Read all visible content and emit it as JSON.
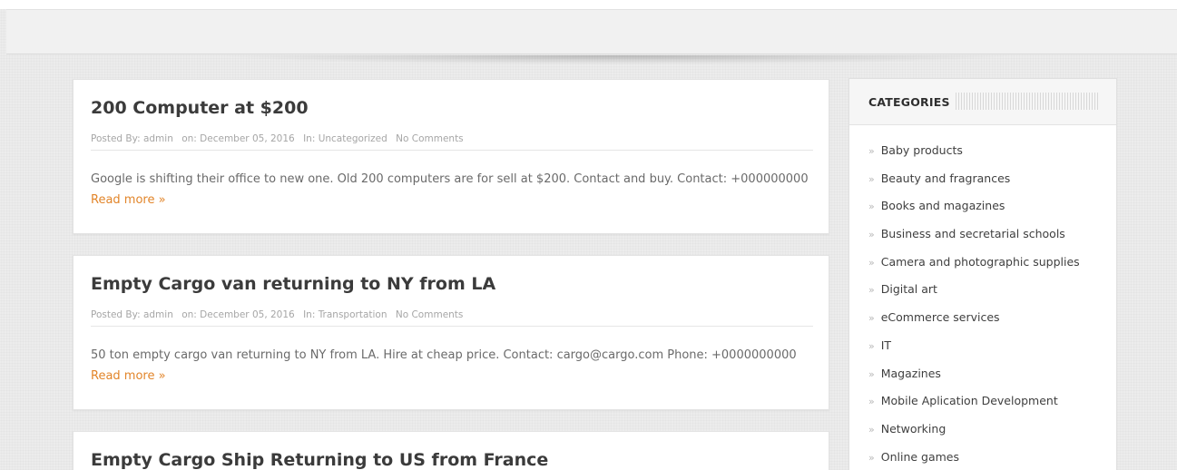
{
  "posts": [
    {
      "title": "200 Computer at $200",
      "meta": {
        "posted_by": "Posted By: admin",
        "date": "on: December 05, 2016",
        "category": "In: Uncategorized",
        "comments": "No Comments"
      },
      "excerpt": "Google is shifting their office to new one. Old 200 computers are for sell at $200. Contact and buy. Contact: +000000000",
      "read_more": "Read more »"
    },
    {
      "title": "Empty Cargo van returning to NY from LA",
      "meta": {
        "posted_by": "Posted By: admin",
        "date": "on: December 05, 2016",
        "category": "In: Transportation",
        "comments": "No Comments"
      },
      "excerpt": "50 ton empty cargo van returning to NY from LA. Hire at cheap price. Contact: cargo@cargo.com Phone: +0000000000",
      "read_more": "Read more »"
    },
    {
      "title": "Empty Cargo Ship Returning to US from France"
    }
  ],
  "sidebar": {
    "title": "CATEGORIES",
    "arrow_glyph": "»",
    "categories": [
      "Baby products",
      "Beauty and fragrances",
      "Books and magazines",
      "Business and secretarial schools",
      "Camera and photographic supplies",
      "Digital art",
      "eCommerce services",
      "IT",
      "Magazines",
      "Mobile Aplication Development",
      "Networking",
      "Online games"
    ]
  },
  "colors": {
    "accent": "#e2852a",
    "title": "#3b3b3b",
    "meta": "#a6a6a6",
    "text": "#6a6a6a"
  }
}
